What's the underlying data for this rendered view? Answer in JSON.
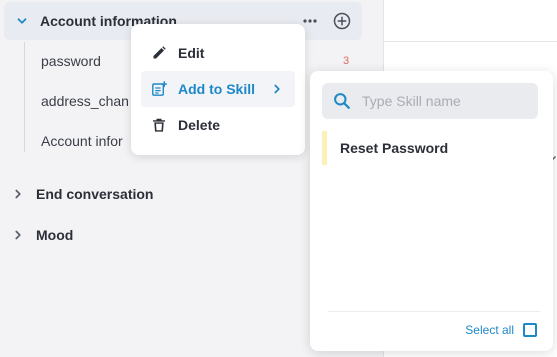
{
  "tree": {
    "header": {
      "label": "Account information"
    },
    "children": [
      "password",
      "address_chan",
      "Account infor"
    ],
    "password_count": "3",
    "groups": [
      "End conversation",
      "Mood"
    ]
  },
  "context_menu": {
    "items": [
      {
        "label": "Edit",
        "icon": "pencil-icon"
      },
      {
        "label": "Add to Skill",
        "icon": "add-note-icon"
      },
      {
        "label": "Delete",
        "icon": "trash-icon"
      }
    ]
  },
  "skill_popover": {
    "search_placeholder": "Type Skill name",
    "items": [
      "Reset Password"
    ],
    "select_all_label": "Select all"
  },
  "colors": {
    "accent": "#1e88c7",
    "count": "#e06a5f",
    "skill_highlight": "#fbf0b8"
  }
}
